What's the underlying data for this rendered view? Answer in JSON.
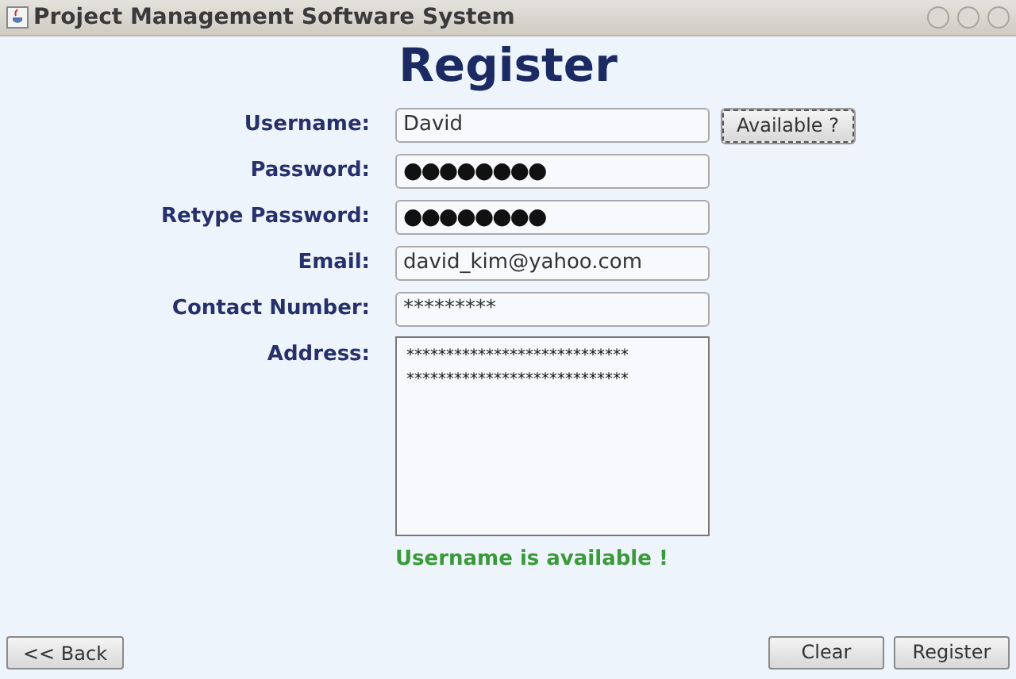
{
  "window": {
    "title": "Project Management Software System"
  },
  "heading": "Register",
  "fields": [
    {
      "label": "Username:",
      "kind": "text",
      "value": "David",
      "button": "Available ?"
    },
    {
      "label": "Password:",
      "kind": "password",
      "value": "●●●●●●●●"
    },
    {
      "label": "Retype Password:",
      "kind": "password",
      "value": "●●●●●●●●"
    },
    {
      "label": "Email:",
      "kind": "text",
      "value": "david_kim@yahoo.com"
    },
    {
      "label": "Contact Number:",
      "kind": "text",
      "value": "*********"
    },
    {
      "label": "Address:",
      "kind": "textarea",
      "lines": [
        "****************************",
        "****************************"
      ]
    }
  ],
  "message": "Username is available !",
  "buttons": {
    "left": [
      "<< Back"
    ],
    "right": [
      "Clear",
      "Register"
    ]
  }
}
